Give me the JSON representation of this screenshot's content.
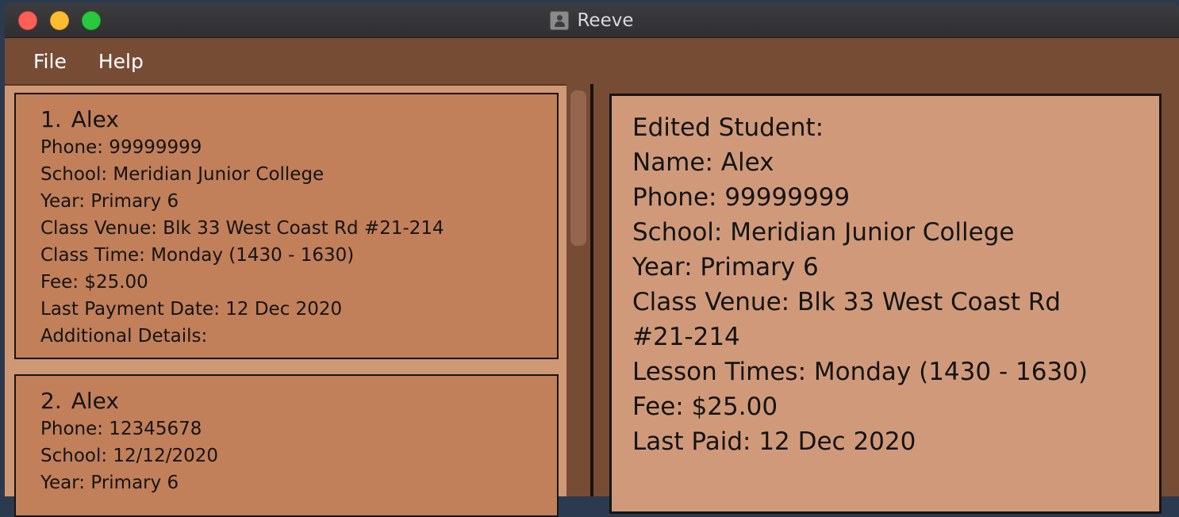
{
  "window": {
    "title": "Reeve",
    "app_icon": "contact-card-icon"
  },
  "menu": {
    "file": "File",
    "help": "Help"
  },
  "students": [
    {
      "index": "1.",
      "name": "Alex",
      "phone": "Phone: 99999999",
      "school": "School: Meridian Junior College",
      "year": "Year: Primary 6",
      "venue": "Class Venue: Blk 33 West Coast Rd #21-214",
      "time": "Class Time: Monday (1430 - 1630)",
      "fee": "Fee: $25.00",
      "last_payment": "Last Payment Date: 12 Dec 2020",
      "details": "Additional Details:"
    },
    {
      "index": "2.",
      "name": "Alex",
      "phone": "Phone: 12345678",
      "school": "School: 12/12/2020",
      "year": "Year: Primary 6"
    }
  ],
  "result": {
    "heading": "Edited Student:",
    "name": "Name: Alex",
    "phone": "Phone: 99999999",
    "school": "School: Meridian Junior College",
    "year": "Year: Primary 6",
    "venue_line1": "Class Venue: Blk 33 West Coast Rd",
    "venue_line2": "#21-214",
    "lesson_times": "Lesson Times: Monday (1430 - 1630)",
    "fee": "Fee: $25.00",
    "last_paid": "Last Paid: 12 Dec 2020"
  },
  "colors": {
    "window_bg": "#764c35",
    "card_bg": "#c17f5a",
    "detail_bg": "#d09a7a"
  }
}
